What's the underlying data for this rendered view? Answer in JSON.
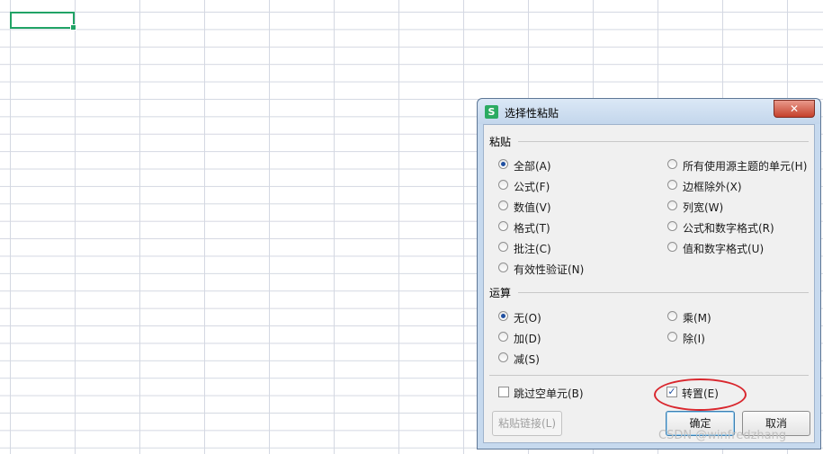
{
  "dialog": {
    "title": "选择性粘贴",
    "close_label": "✕",
    "app_icon_glyph": "S",
    "paste_group": {
      "label": "粘贴",
      "options_left": [
        {
          "label": "全部(A)",
          "selected": true
        },
        {
          "label": "公式(F)",
          "selected": false
        },
        {
          "label": "数值(V)",
          "selected": false
        },
        {
          "label": "格式(T)",
          "selected": false
        },
        {
          "label": "批注(C)",
          "selected": false
        },
        {
          "label": "有效性验证(N)",
          "selected": false
        }
      ],
      "options_right": [
        {
          "label": "所有使用源主题的单元(H)",
          "selected": false
        },
        {
          "label": "边框除外(X)",
          "selected": false
        },
        {
          "label": "列宽(W)",
          "selected": false
        },
        {
          "label": "公式和数字格式(R)",
          "selected": false
        },
        {
          "label": "值和数字格式(U)",
          "selected": false
        }
      ]
    },
    "operation_group": {
      "label": "运算",
      "options_left": [
        {
          "label": "无(O)",
          "selected": true
        },
        {
          "label": "加(D)",
          "selected": false
        },
        {
          "label": "减(S)",
          "selected": false
        }
      ],
      "options_right": [
        {
          "label": "乘(M)",
          "selected": false
        },
        {
          "label": "除(I)",
          "selected": false
        }
      ]
    },
    "skip_blanks": {
      "label": "跳过空单元(B)",
      "checked": false
    },
    "transpose": {
      "label": "转置(E)",
      "checked": true
    },
    "buttons": {
      "paste_link": "粘贴链接(L)",
      "ok": "确定",
      "cancel": "取消"
    }
  },
  "watermark": "CSDN @winfredzhang",
  "colors": {
    "active_cell": "#21a366",
    "annotation": "#d9272e",
    "dialog_frame": "#c6d9ee"
  }
}
